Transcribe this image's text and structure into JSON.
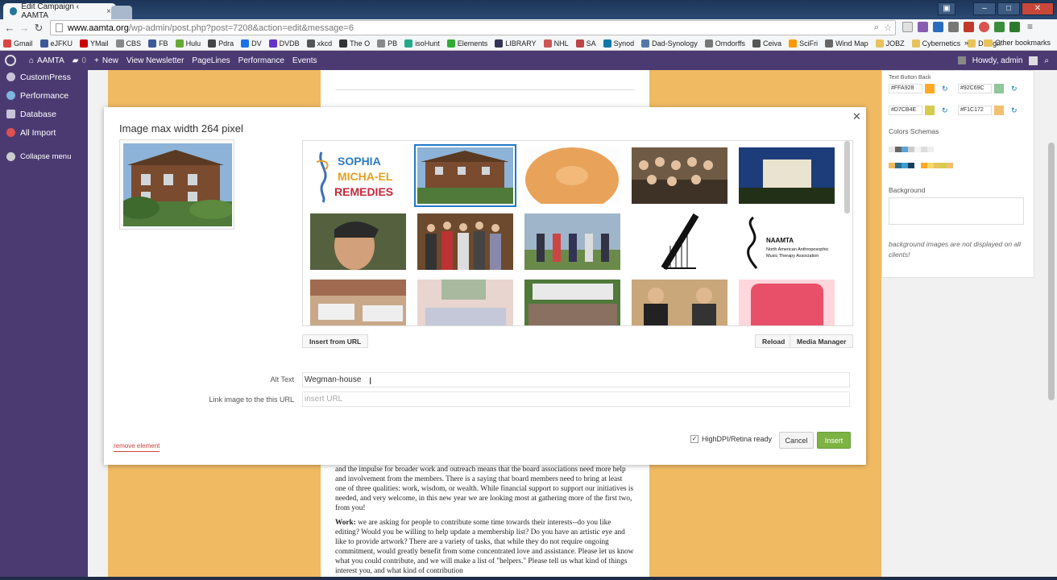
{
  "browser": {
    "tab_title": "Edit Campaign ‹ AAMTA",
    "url_host": "www.aamta.org",
    "url_path": "/wp-admin/post.php?post=7208&action=edit&message=6"
  },
  "bookmarks": [
    "Gmail",
    "eJFKU",
    "YMail",
    "CBS",
    "FB",
    "Hulu",
    "Pdra",
    "DV",
    "DVDB",
    "xkcd",
    "The O",
    "PB",
    "isoHunt",
    "Elements",
    "LIBRARY",
    "NHL",
    "SA",
    "Synod",
    "Dad-Synology",
    "Orndorffs",
    "Ceiva",
    "SciFri",
    "Wind Map",
    "JOBZ",
    "Cybernetics",
    "Design"
  ],
  "bookmarks_more": "»",
  "bookmarks_other": "Other bookmarks",
  "adminbar": {
    "site": "AAMTA",
    "comments": "0",
    "new": "New",
    "items": [
      "View Newsletter",
      "PageLines",
      "Performance",
      "Events"
    ],
    "howdy": "Howdy, admin"
  },
  "sidebar": {
    "items": [
      "CustomPress",
      "Performance",
      "Database",
      "All Import"
    ],
    "collapse": "Collapse menu"
  },
  "modal": {
    "title": "Image max width 264 pixel",
    "insert_from_url": "Insert from URL",
    "reload": "Reload",
    "media_manager": "Media Manager",
    "alt_text_label": "Alt Text",
    "alt_text_value": "Wegman-house",
    "link_label": "Link image to the this URL",
    "link_placeholder": "insert URL",
    "remove": "remove element",
    "hidpi": "HighDPI/Retina ready",
    "cancel": "Cancel",
    "insert": "Insert",
    "thumb_logo1": [
      "SOPHIA",
      "MICHA-EL",
      "REMEDIES"
    ],
    "thumb_logo2": [
      "NAAMTA",
      "North American Anthroposophic",
      "Music Therapy Association"
    ]
  },
  "right_panel": {
    "text_button_back": "Text Button Back",
    "colors": [
      {
        "hex": "#FFA928",
        "color": "#ffa928"
      },
      {
        "hex": "#92C69C",
        "color": "#92c69c"
      },
      {
        "hex": "#D7CB4E",
        "color": "#d7cb4e"
      },
      {
        "hex": "#F1C172",
        "color": "#f1c172"
      }
    ],
    "colors_schemas": "Colors Schemas",
    "background": "Background",
    "note": "background images are not displayed on all clients!"
  },
  "newsletter": {
    "p1": "and the impulse for broader work and outreach means that the board associations need more help and involvement from the members.  There is a saying that board members need to bring at least one of three qualities: work, wisdom, or wealth.  While financial support to support our initiatives is needed, and very welcome, in this new year we are looking most at gathering more of the first two, from you!",
    "p2_bold": "Work:",
    "p2": " we are asking for people to contribute some time towards their interests--do you like editing?  Would you be willing to help update a membership list?  Do you have an artistic eye and like to provide artwork?  There are a variety of tasks, that while they do not require ongoing commitment, would greatly benefit from some concentrated love and assistance.  Please let us know what you could contribute, and we will make a list of \"helpers.\"  Please tell us what kind of things interest you, and what kind of contribution"
  }
}
